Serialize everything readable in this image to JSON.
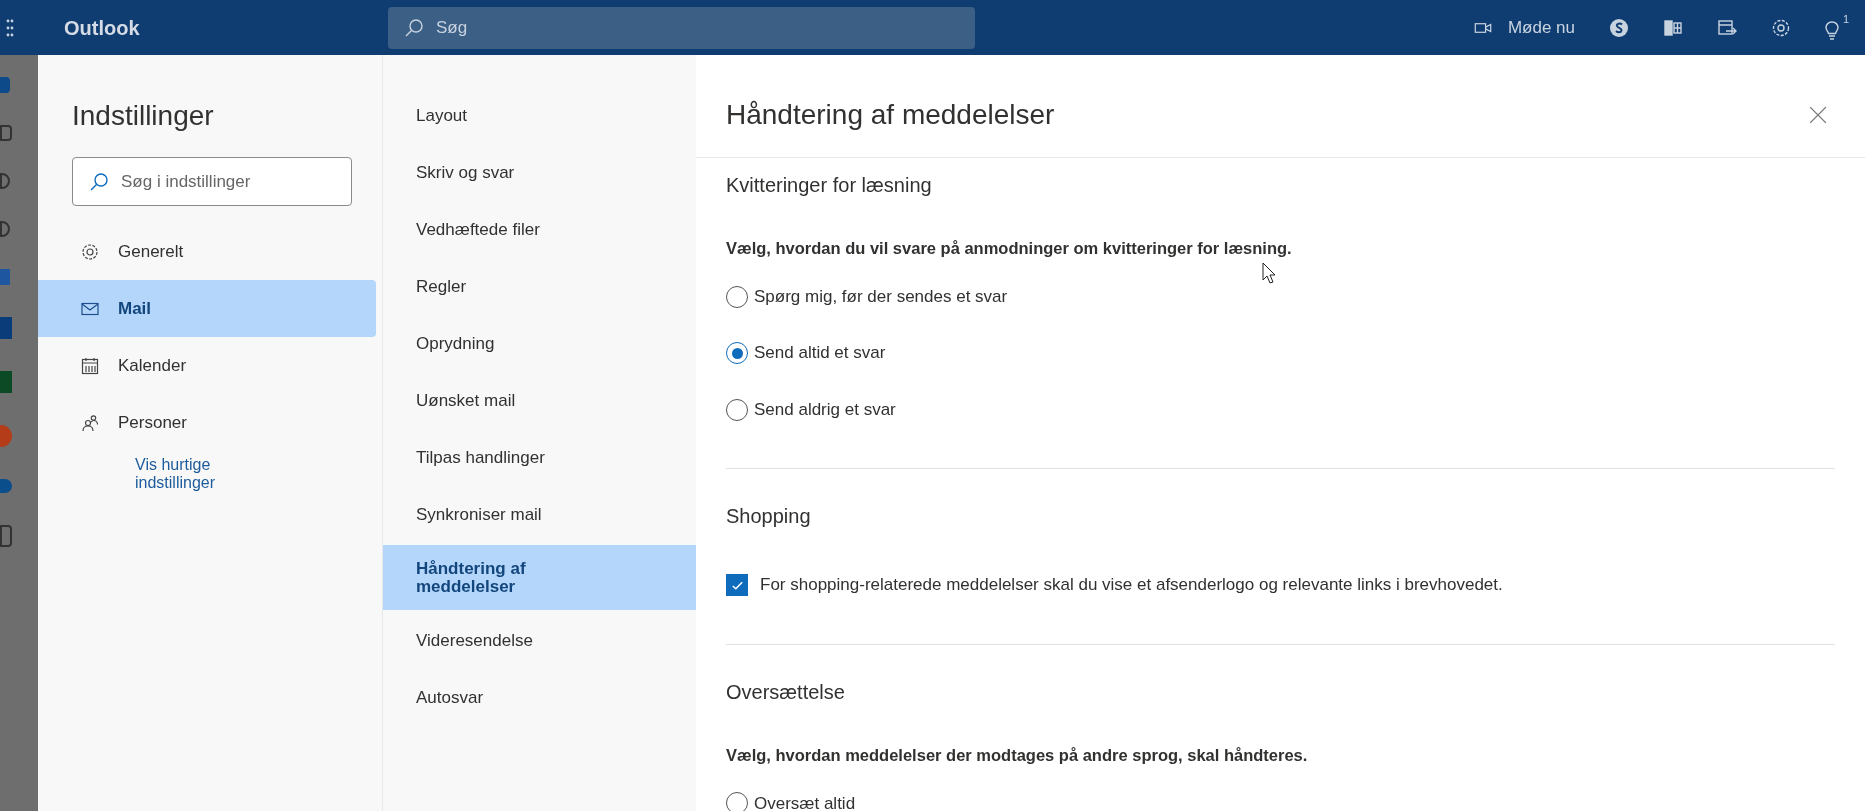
{
  "topbar": {
    "app_name": "Outlook",
    "search": {
      "placeholder": "Søg"
    },
    "meet_now": "Møde nu",
    "tips_badge": "1"
  },
  "settings": {
    "title": "Indstillinger",
    "search": {
      "placeholder": "Søg i indstillinger"
    },
    "categories": [
      {
        "label": "Generelt",
        "selected": false
      },
      {
        "label": "Mail",
        "selected": true
      },
      {
        "label": "Kalender",
        "selected": false
      },
      {
        "label": "Personer",
        "selected": false
      }
    ],
    "quick_settings_link": "Vis hurtige indstillinger",
    "subcategories": [
      {
        "label": "Layout",
        "selected": false
      },
      {
        "label": "Skriv og svar",
        "selected": false
      },
      {
        "label": "Vedhæftede filer",
        "selected": false
      },
      {
        "label": "Regler",
        "selected": false
      },
      {
        "label": "Oprydning",
        "selected": false
      },
      {
        "label": "Uønsket mail",
        "selected": false
      },
      {
        "label": "Tilpas handlinger",
        "selected": false
      },
      {
        "label": "Synkroniser mail",
        "selected": false
      },
      {
        "label": "Håndtering af meddelelser",
        "selected": true
      },
      {
        "label": "Videresendelse",
        "selected": false
      },
      {
        "label": "Autosvar",
        "selected": false
      }
    ]
  },
  "panel": {
    "title": "Håndtering af meddelelser",
    "sections": [
      {
        "kind": "radio",
        "heading": "Kvitteringer for læsning",
        "description": "Vælg, hvordan du vil svare på anmodninger om kvitteringer for læsning.",
        "options": [
          {
            "label": "Spørg mig, før der sendes et svar",
            "selected": false
          },
          {
            "label": "Send altid et svar",
            "selected": true
          },
          {
            "label": "Send aldrig et svar",
            "selected": false
          }
        ]
      },
      {
        "kind": "checkbox",
        "heading": "Shopping",
        "options": [
          {
            "label": "For shopping-relaterede meddelelser skal du vise et afsenderlogo og relevante links i brevhovedet.",
            "checked": true
          }
        ]
      },
      {
        "kind": "radio",
        "heading": "Oversættelse",
        "description": "Vælg, hvordan meddelelser der modtages på andre sprog, skal håndteres.",
        "options": [
          {
            "label": "Oversæt altid",
            "selected": false
          }
        ]
      }
    ]
  }
}
